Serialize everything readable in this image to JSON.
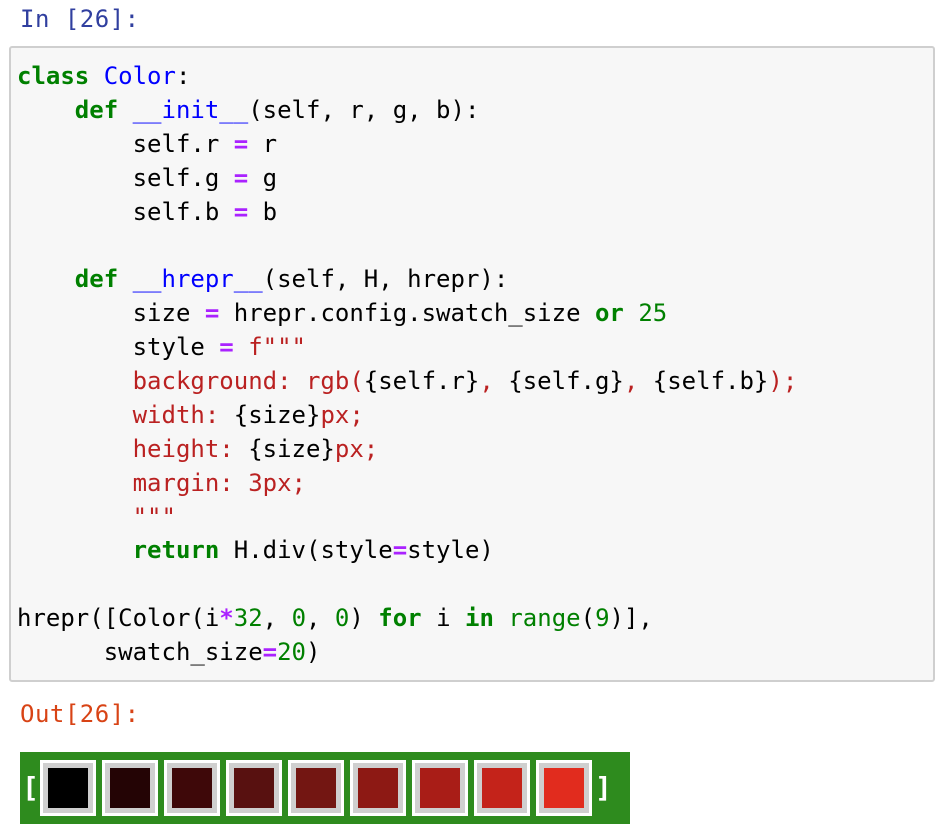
{
  "input_prompt": "In [26]:",
  "output_prompt": "Out[26]:",
  "code_lines": [
    [
      {
        "t": "class",
        "c": "kw"
      },
      {
        "t": " ",
        "c": ""
      },
      {
        "t": "Color",
        "c": "cls"
      },
      {
        "t": ":",
        "c": ""
      }
    ],
    [
      {
        "t": "    ",
        "c": ""
      },
      {
        "t": "def",
        "c": "kw"
      },
      {
        "t": " ",
        "c": ""
      },
      {
        "t": "__init__",
        "c": "fn"
      },
      {
        "t": "(self, r, g, b):",
        "c": ""
      }
    ],
    [
      {
        "t": "        self.r ",
        "c": ""
      },
      {
        "t": "=",
        "c": "op"
      },
      {
        "t": " r",
        "c": ""
      }
    ],
    [
      {
        "t": "        self.g ",
        "c": ""
      },
      {
        "t": "=",
        "c": "op"
      },
      {
        "t": " g",
        "c": ""
      }
    ],
    [
      {
        "t": "        self.b ",
        "c": ""
      },
      {
        "t": "=",
        "c": "op"
      },
      {
        "t": " b",
        "c": ""
      }
    ],
    [
      {
        "t": "",
        "c": ""
      }
    ],
    [
      {
        "t": "    ",
        "c": ""
      },
      {
        "t": "def",
        "c": "kw"
      },
      {
        "t": " ",
        "c": ""
      },
      {
        "t": "__hrepr__",
        "c": "fn"
      },
      {
        "t": "(self, H, hrepr):",
        "c": ""
      }
    ],
    [
      {
        "t": "        size ",
        "c": ""
      },
      {
        "t": "=",
        "c": "op"
      },
      {
        "t": " hrepr.config.swatch_size ",
        "c": ""
      },
      {
        "t": "or",
        "c": "kw"
      },
      {
        "t": " ",
        "c": ""
      },
      {
        "t": "25",
        "c": "num"
      }
    ],
    [
      {
        "t": "        style ",
        "c": ""
      },
      {
        "t": "=",
        "c": "op"
      },
      {
        "t": " ",
        "c": ""
      },
      {
        "t": "f\"\"\"",
        "c": "str"
      }
    ],
    [
      {
        "t": "        background: rgb(",
        "c": "str"
      },
      {
        "t": "{self.r}",
        "c": "sub"
      },
      {
        "t": ", ",
        "c": "str"
      },
      {
        "t": "{self.g}",
        "c": "sub"
      },
      {
        "t": ", ",
        "c": "str"
      },
      {
        "t": "{self.b}",
        "c": "sub"
      },
      {
        "t": ");",
        "c": "str"
      }
    ],
    [
      {
        "t": "        width: ",
        "c": "str"
      },
      {
        "t": "{size}",
        "c": "sub"
      },
      {
        "t": "px;",
        "c": "str"
      }
    ],
    [
      {
        "t": "        height: ",
        "c": "str"
      },
      {
        "t": "{size}",
        "c": "sub"
      },
      {
        "t": "px;",
        "c": "str"
      }
    ],
    [
      {
        "t": "        margin: 3px;",
        "c": "str"
      }
    ],
    [
      {
        "t": "        \"\"\"",
        "c": "str"
      }
    ],
    [
      {
        "t": "        ",
        "c": ""
      },
      {
        "t": "return",
        "c": "kw"
      },
      {
        "t": " H.div(style",
        "c": ""
      },
      {
        "t": "=",
        "c": "op"
      },
      {
        "t": "style)",
        "c": ""
      }
    ],
    [
      {
        "t": "",
        "c": ""
      }
    ],
    [
      {
        "t": "hrepr([Color(i",
        "c": ""
      },
      {
        "t": "*",
        "c": "op"
      },
      {
        "t": "32",
        "c": "num"
      },
      {
        "t": ", ",
        "c": ""
      },
      {
        "t": "0",
        "c": "num"
      },
      {
        "t": ", ",
        "c": ""
      },
      {
        "t": "0",
        "c": "num"
      },
      {
        "t": ") ",
        "c": ""
      },
      {
        "t": "for",
        "c": "kw"
      },
      {
        "t": " i ",
        "c": ""
      },
      {
        "t": "in",
        "c": "kw"
      },
      {
        "t": " ",
        "c": ""
      },
      {
        "t": "range",
        "c": "num"
      },
      {
        "t": "(",
        "c": ""
      },
      {
        "t": "9",
        "c": "num"
      },
      {
        "t": ")],",
        "c": ""
      }
    ],
    [
      {
        "t": "      swatch_size",
        "c": ""
      },
      {
        "t": "=",
        "c": "op"
      },
      {
        "t": "20",
        "c": "num"
      },
      {
        "t": ")",
        "c": ""
      }
    ]
  ],
  "output": {
    "open_bracket": "[",
    "close_bracket": "]",
    "swatches": [
      "#000000",
      "#200000",
      "#400000",
      "#600000",
      "#800000",
      "#a00000",
      "#c00000",
      "#e00000",
      "#ff0000"
    ],
    "swatch_display_colors": [
      "#000000",
      "#240405",
      "#3e0809",
      "#581110",
      "#731612",
      "#8d1914",
      "#a91d17",
      "#c4231a",
      "#e12c1e"
    ]
  }
}
